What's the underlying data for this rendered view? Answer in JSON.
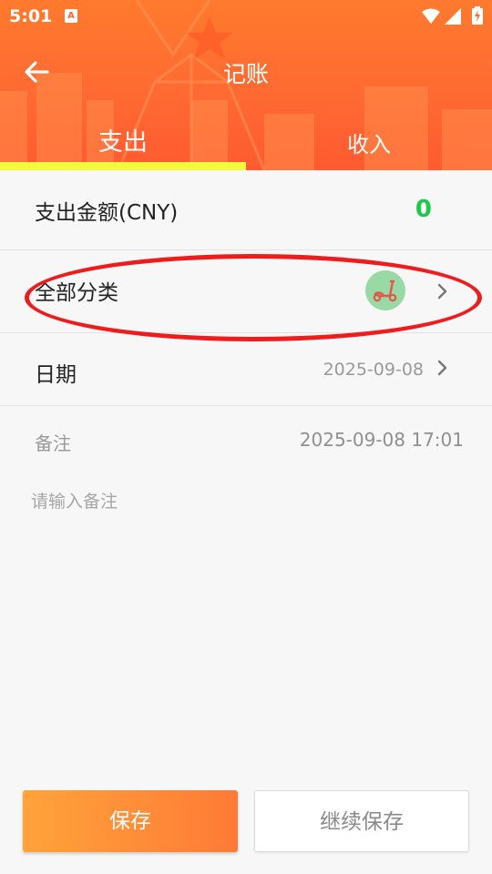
{
  "status_bar": {
    "time": "5:01",
    "notification_icon": "accessibility-a-icon",
    "icons": [
      "wifi-icon",
      "signal-icon",
      "battery-charging-icon"
    ]
  },
  "header": {
    "title": "记账",
    "back_icon": "arrow-left-icon",
    "tabs": [
      {
        "label": "支出",
        "selected": true
      },
      {
        "label": "收入",
        "selected": false
      }
    ],
    "indicator_color": "#f3fa3c"
  },
  "form": {
    "amount_label": "支出金额(CNY)",
    "amount_value": "0",
    "category_label": "全部分类",
    "category_icon": "scooter-icon",
    "date_label": "日期",
    "date_value": "2025-09-08",
    "remark_label": "备注",
    "remark_datetime": "2025-09-08  17:01",
    "remark_placeholder": "请输入备注",
    "remark_value": ""
  },
  "buttons": {
    "save": "保存",
    "continue_save": "继续保存"
  },
  "colors": {
    "header_orange": "#ff6a32",
    "amount_green": "#1fc84a",
    "annotation_red": "#ee1c1c"
  }
}
